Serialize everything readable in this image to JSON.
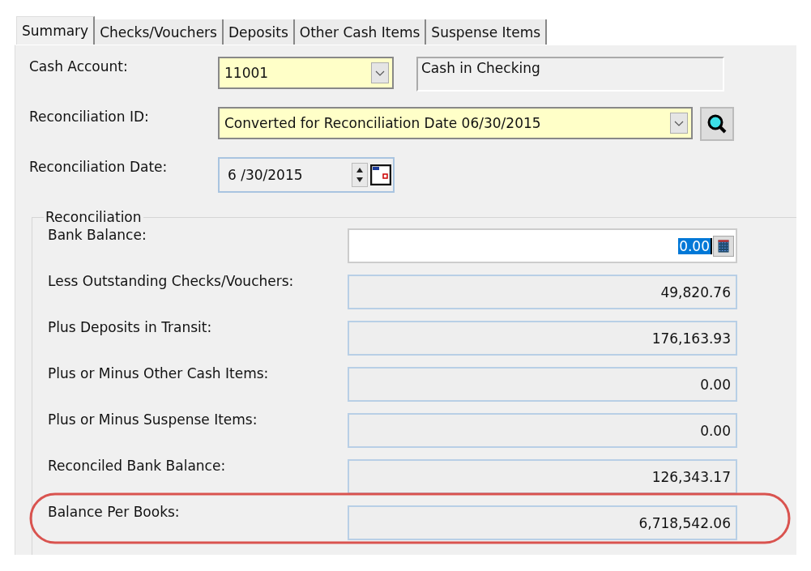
{
  "tabs": [
    {
      "label": "Summary",
      "selected": true
    },
    {
      "label": "Checks/Vouchers",
      "selected": false
    },
    {
      "label": "Deposits",
      "selected": false
    },
    {
      "label": "Other Cash Items",
      "selected": false
    },
    {
      "label": "Suspense Items",
      "selected": false
    }
  ],
  "cash_account": {
    "label": "Cash Account:",
    "value": "11001",
    "description": "Cash in Checking"
  },
  "reconciliation_id": {
    "label": "Reconciliation ID:",
    "value": "Converted for Reconciliation Date 06/30/2015"
  },
  "reconciliation_date": {
    "label": "Reconciliation Date:",
    "value": "6 /30/2015"
  },
  "reconciliation": {
    "title": "Reconciliation",
    "rows": [
      {
        "kind": "input",
        "label": "Bank Balance:",
        "value": "0.00",
        "circled": false
      },
      {
        "kind": "readonly",
        "label": "Less Outstanding Checks/Vouchers:",
        "value": "49,820.76",
        "circled": false
      },
      {
        "kind": "readonly",
        "label": "Plus Deposits in Transit:",
        "value": "176,163.93",
        "circled": false
      },
      {
        "kind": "readonly",
        "label": "Plus or Minus Other Cash Items:",
        "value": "0.00",
        "circled": false
      },
      {
        "kind": "readonly",
        "label": "Plus or Minus Suspense Items:",
        "value": "0.00",
        "circled": false
      },
      {
        "kind": "readonly",
        "label": "Reconciled Bank Balance:",
        "value": "126,343.17",
        "circled": false
      },
      {
        "kind": "readonly",
        "label": "Balance Per Books:",
        "value": "6,718,542.06",
        "circled": true
      }
    ]
  }
}
